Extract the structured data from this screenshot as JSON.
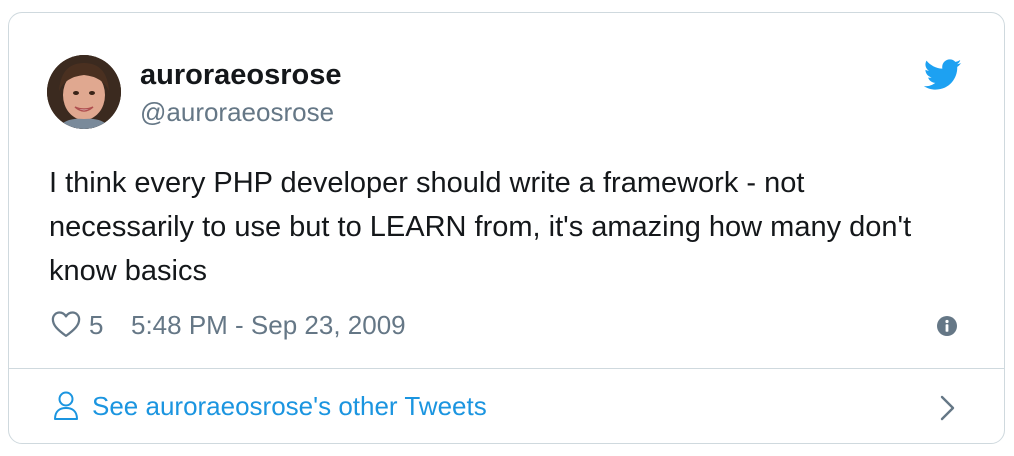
{
  "tweet": {
    "display_name": "auroraeosrose",
    "handle": "@auroraeosrose",
    "text": "I think every PHP developer should write a framework - not necessarily to use but to LEARN from, it's amazing how many don't know basics",
    "like_count": "5",
    "timestamp": "5:48 PM - Sep 23, 2009"
  },
  "footer": {
    "link_label": "See auroraeosrose's other Tweets"
  },
  "icons": {
    "brand": "twitter-bird-icon",
    "like": "heart-icon",
    "info": "info-icon",
    "profile": "person-icon",
    "next": "chevron-right-icon"
  },
  "colors": {
    "brand_blue": "#1da1f2",
    "link_blue": "#1b95e0",
    "secondary_text": "#657786",
    "primary_text": "#14171a",
    "border": "#cfd9de"
  }
}
